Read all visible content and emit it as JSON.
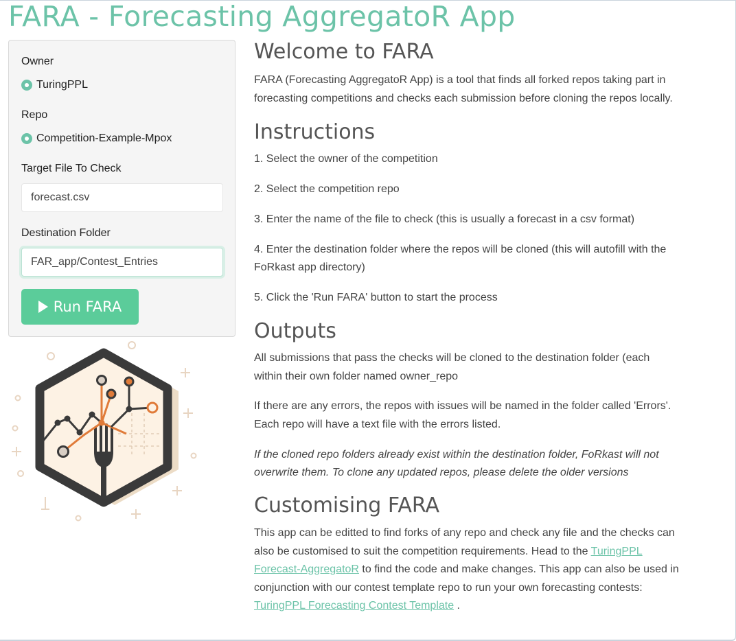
{
  "app": {
    "title": "FARA - Forecasting AggregatoR App"
  },
  "sidebar": {
    "owner_label": "Owner",
    "owner_option": "TuringPPL",
    "repo_label": "Repo",
    "repo_option": "Competition-Example-Mpox",
    "target_label": "Target File To Check",
    "target_value": "forecast.csv",
    "dest_label": "Destination Folder",
    "dest_value": "FAR_app/Contest_Entries",
    "run_label": "Run FARA"
  },
  "logo": {
    "icon": "fara-fork-chart-logo"
  },
  "main": {
    "welcome_heading": "Welcome to FARA",
    "intro_line1": "FARA (Forecasting AggregatoR App) is a tool that finds all forked repos taking part in",
    "intro_line2": "forecasting competitions and checks each submission before cloning the repos locally.",
    "instructions_heading": "Instructions",
    "step1": "1. Select the owner of the competition",
    "step2": "2. Select the competition repo",
    "step3": "3. Enter the name of the file to check (this is usually a forecast in a csv format)",
    "step4_line1": "4. Enter the destination folder where the repos will be cloned (this will autofill with the",
    "step4_line2": "FoRkast app directory)",
    "step5": "5. Click the 'Run FARA' button to start the process",
    "outputs_heading": "Outputs",
    "outputs_p1_line1": "All submissions that pass the checks will be cloned to the destination folder (each",
    "outputs_p1_line2": "within their own folder named owner_repo",
    "outputs_p2_line1": "If there are any errors, the repos with issues will be named in the folder called 'Errors'.",
    "outputs_p2_line2": "Each repo will have a text file with the errors listed.",
    "outputs_note_line1": "If the cloned repo folders already exist within the destination folder, FoRkast will not",
    "outputs_note_line2": "overwrite them. To clone any updated repos, please delete the older versions",
    "custom_heading": "Customising FARA",
    "custom_line1": "This app can be editted to find forks of any repo and check any file and the checks can",
    "custom_line2_pre": "also be customised to suit the competition requirements. Head to the ",
    "custom_link1_a": "TuringPPL",
    "custom_link1_b": "Forecast-AggregatoR",
    "custom_line3_post": " to find the code and make changes. This app can also be used in",
    "custom_line4": "conjunction with our contest template repo to run your own forecasting contests:",
    "custom_link2": "TuringPPL Forecasting Contest Template",
    "custom_end": " ."
  },
  "colors": {
    "accent": "#6cc3a8",
    "button": "#5bcc9a",
    "logo_orange": "#e07b39",
    "logo_dark": "#3a3a3a"
  }
}
